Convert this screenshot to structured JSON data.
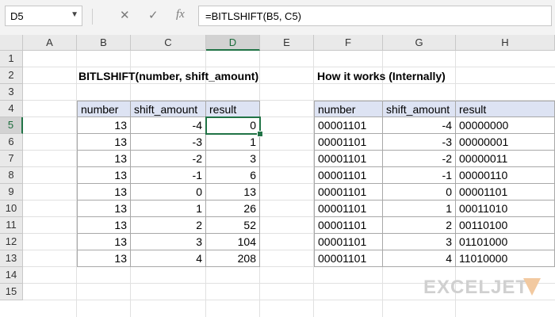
{
  "name_box": {
    "value": "D5"
  },
  "formula_bar": {
    "cancel_icon": "✕",
    "enter_icon": "✓",
    "fx_label": "fx",
    "formula": "=BITLSHIFT(B5, C5)"
  },
  "columns": [
    "A",
    "B",
    "C",
    "D",
    "E",
    "F",
    "G",
    "H"
  ],
  "active_column": "D",
  "rows": [
    "1",
    "2",
    "3",
    "4",
    "5",
    "6",
    "7",
    "8",
    "9",
    "10",
    "11",
    "12",
    "13",
    "14",
    "15"
  ],
  "active_row": "5",
  "headings": {
    "left": "BITLSHIFT(number, shift_amount)",
    "right": "How it works (Internally)"
  },
  "left_table": {
    "headers": [
      "number",
      "shift_amount",
      "result"
    ],
    "rows": [
      [
        "13",
        "-4",
        "0"
      ],
      [
        "13",
        "-3",
        "1"
      ],
      [
        "13",
        "-2",
        "3"
      ],
      [
        "13",
        "-1",
        "6"
      ],
      [
        "13",
        "0",
        "13"
      ],
      [
        "13",
        "1",
        "26"
      ],
      [
        "13",
        "2",
        "52"
      ],
      [
        "13",
        "3",
        "104"
      ],
      [
        "13",
        "4",
        "208"
      ]
    ]
  },
  "right_table": {
    "headers": [
      "number",
      "shift_amount",
      "result"
    ],
    "rows": [
      [
        "00001101",
        "-4",
        "00000000"
      ],
      [
        "00001101",
        "-3",
        "00000001"
      ],
      [
        "00001101",
        "-2",
        "00000011"
      ],
      [
        "00001101",
        "-1",
        "00000110"
      ],
      [
        "00001101",
        "0",
        "00001101"
      ],
      [
        "00001101",
        "1",
        "00011010"
      ],
      [
        "00001101",
        "2",
        "00110100"
      ],
      [
        "00001101",
        "3",
        "01101000"
      ],
      [
        "00001101",
        "4",
        "11010000"
      ]
    ]
  },
  "logo": {
    "text": "EXCELJET"
  },
  "colors": {
    "accent": "#217346",
    "table_header": "#dde3f3"
  }
}
